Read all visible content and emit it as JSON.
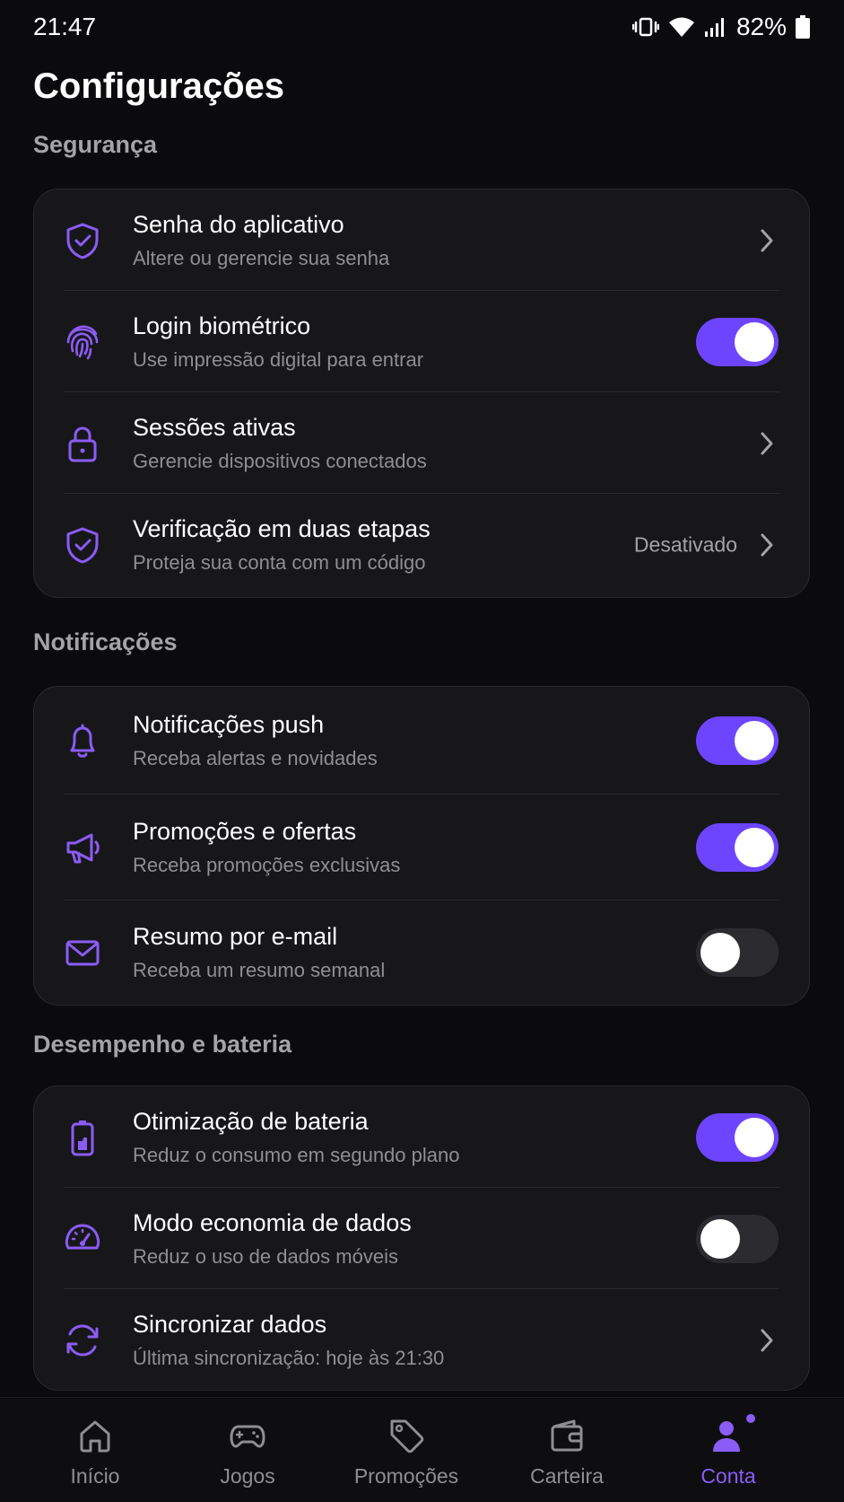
{
  "status_bar": {
    "time": "21:47",
    "battery": "82%",
    "icons": [
      "vibrate-icon",
      "wifi-icon",
      "signal-icon",
      "battery-icon"
    ]
  },
  "page_title": "Configurações",
  "colors": {
    "accent": "#6d45ff",
    "icon": "#8b5cf6",
    "background": "#0b0b0d",
    "card": "#17171a"
  },
  "sections": [
    {
      "title": "Segurança",
      "items": [
        {
          "icon": "shield-check-icon",
          "label": "Senha do aplicativo",
          "sub": "Altere ou gerencie sua senha",
          "control": "chevron"
        },
        {
          "icon": "fingerprint-icon",
          "label": "Login biométrico",
          "sub": "Use impressão digital para entrar",
          "control": "toggle",
          "on": true
        },
        {
          "icon": "lock-icon",
          "label": "Sessões ativas",
          "sub": "Gerencie dispositivos conectados",
          "control": "chevron"
        },
        {
          "icon": "shield-check-icon",
          "label": "Verificação em duas etapas",
          "sub": "Proteja sua conta com um código",
          "control": "chevron",
          "value": "Desativado"
        }
      ]
    },
    {
      "title": "Notificações",
      "items": [
        {
          "icon": "bell-icon",
          "label": "Notificações push",
          "sub": "Receba alertas e novidades",
          "control": "toggle",
          "on": true
        },
        {
          "icon": "megaphone-icon",
          "label": "Promoções e ofertas",
          "sub": "Receba promoções exclusivas",
          "control": "toggle",
          "on": true
        },
        {
          "icon": "mail-icon",
          "label": "Resumo por e-mail",
          "sub": "Receba um resumo semanal",
          "control": "toggle",
          "on": false
        }
      ]
    },
    {
      "title": "Desempenho e bateria",
      "items": [
        {
          "icon": "battery-charging-icon",
          "label": "Otimização de bateria",
          "sub": "Reduz o consumo em segundo plano",
          "control": "toggle",
          "on": true
        },
        {
          "icon": "speedometer-icon",
          "label": "Modo economia de dados",
          "sub": "Reduz o uso de dados móveis",
          "control": "toggle",
          "on": false
        },
        {
          "icon": "sync-icon",
          "label": "Sincronizar dados",
          "sub": "Última sincronização: hoje às 21:30",
          "control": "chevron"
        }
      ]
    }
  ],
  "bottom_nav": [
    {
      "icon": "home-icon",
      "label": "Início",
      "active": false
    },
    {
      "icon": "gamepad-icon",
      "label": "Jogos",
      "active": false
    },
    {
      "icon": "tag-icon",
      "label": "Promoções",
      "active": false
    },
    {
      "icon": "wallet-icon",
      "label": "Carteira",
      "active": false
    },
    {
      "icon": "user-icon",
      "label": "Conta",
      "active": true
    }
  ]
}
